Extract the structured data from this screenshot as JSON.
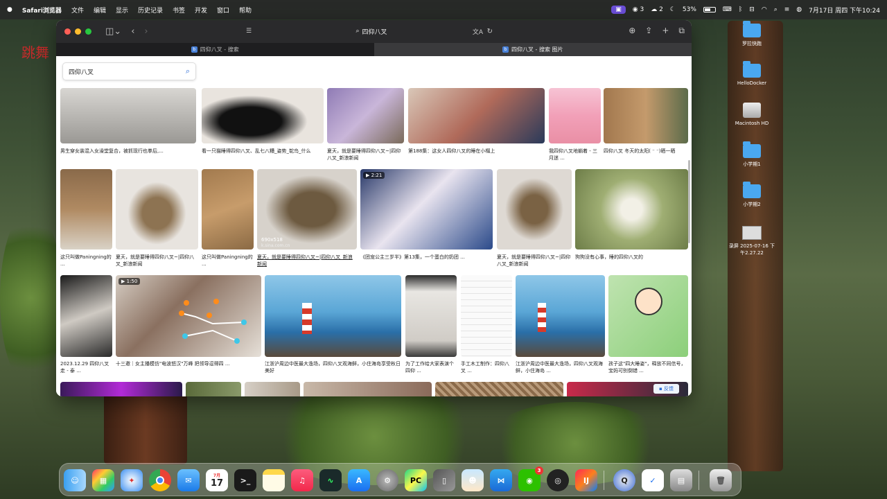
{
  "menubar": {
    "app_name": "Safari浏览器",
    "items": [
      "文件",
      "编辑",
      "显示",
      "历史记录",
      "书签",
      "开发",
      "窗口",
      "帮助"
    ],
    "wechat_count": "3",
    "cloud_count": "2",
    "battery": "53%",
    "datetime": "7月17日 周四 下午10:24"
  },
  "browser": {
    "address": "四仰八叉",
    "tabs": [
      {
        "label": "四仰八叉 - 搜索",
        "favicon": "b"
      },
      {
        "label": "四仰八叉 - 搜索 图片",
        "favicon": "b"
      }
    ]
  },
  "search": {
    "query": "四仰八叉"
  },
  "results": {
    "row1": [
      {
        "caption": "男生穿女装混入女澡堂复合，被抓现行也拳后,..."
      },
      {
        "caption": "看一只猫睡得四仰八叉、乱七八糟_姿势_鸵鸟_什么"
      },
      {
        "caption": "夏天，就是要睡得四仰八叉~|四仰八叉_新浪新闻"
      },
      {
        "caption": "第188集：这女人四仰八叉的睡在小榻上"
      },
      {
        "caption": "我四仰八叉地躺着 - 三月迷 ..."
      },
      {
        "caption": "四仰八叉 冬天的太阳( ⁻ ⁻)晒一晒"
      }
    ],
    "row2": [
      {
        "caption": "这只叫做Paningning的 ..."
      },
      {
        "caption": "夏天，就是要睡得四仰八叉~|四仰八叉_新浪新闻"
      },
      {
        "caption": "这只叫做Paningning的 ..."
      },
      {
        "caption": "夏天，就是要睡得四仰八叉~|四仰八叉_新浪新闻",
        "size": "690x518",
        "source": "k.sina.com.cn"
      },
      {
        "caption": "《团宠公主三岁半》第13集，一个蛋白的奶团 ...",
        "duration": "2:21"
      },
      {
        "caption": "夏天，就是要睡得四仰八叉~|四仰八叉_新浪新闻"
      },
      {
        "caption": "狗狗没有心事，睡的四仰八叉的"
      }
    ],
    "row3": [
      {
        "caption": "2023.12.29 四仰八叉走 - 泰 ..."
      },
      {
        "caption": "十三邀｜女主播模仿\"电波怒汉\"万峰 把领导逗得四 ...",
        "duration": "1:50"
      },
      {
        "caption": "江浙沪周边中医最大渔场，四仰八叉观海鲜，小住海岛享受秋日美好"
      },
      {
        "caption": "为了工作给大家表演个四仰 ..."
      },
      {
        "caption": "手工木工制作：四仰八叉 ..."
      },
      {
        "caption": "江浙沪周边中医最大渔场，四仰八叉观海鲜，小住海岛 ..."
      },
      {
        "caption": "孩子这\"四大睡姿\"，释放不同信号，宝妈可别倒错 ..."
      }
    ],
    "feedback_label": "反馈"
  },
  "desktop": {
    "watermark": "跳舞",
    "icons": [
      "罗拉快跑",
      "HelloDocker",
      "Macintosh HD",
      "小学期1",
      "小学期2",
      "录屏 2025-07-16 下午2.27.22"
    ]
  },
  "dock": {
    "calendar_month": "7月",
    "calendar_day": "17",
    "wechat_badge": "3"
  }
}
